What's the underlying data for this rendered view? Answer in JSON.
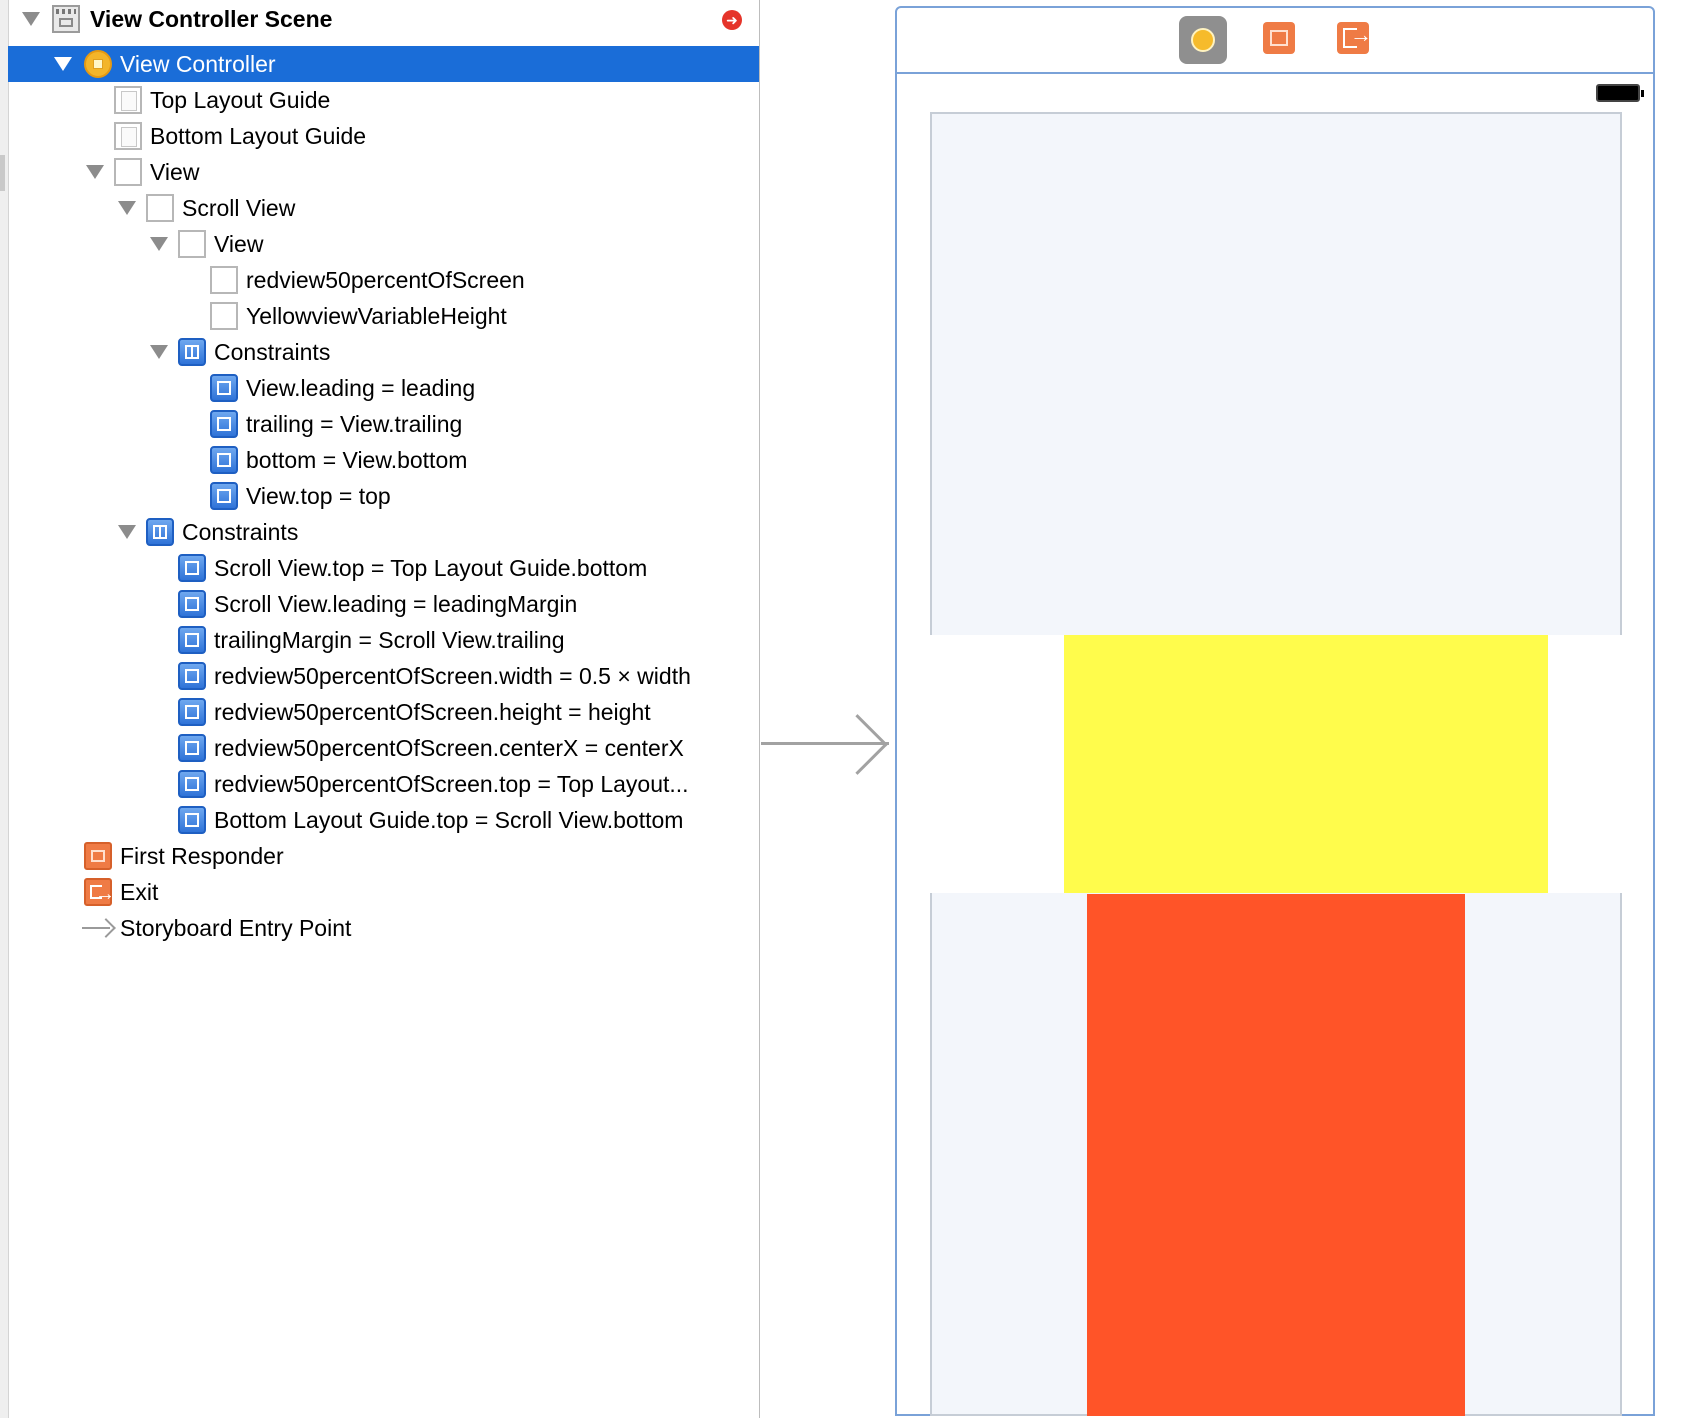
{
  "outline": {
    "scene_title": "View Controller Scene",
    "warning_badge": "➜",
    "rows": [
      {
        "label": "View Controller",
        "icon": "view-controller-icon"
      },
      {
        "label": "Top Layout Guide",
        "icon": "layout-guide-icon"
      },
      {
        "label": "Bottom Layout Guide",
        "icon": "layout-guide-icon"
      },
      {
        "label": "View",
        "icon": "view-icon"
      },
      {
        "label": "Scroll View",
        "icon": "view-icon"
      },
      {
        "label": "View",
        "icon": "view-icon"
      },
      {
        "label": "redview50percentOfScreen",
        "icon": "view-icon"
      },
      {
        "label": "YellowviewVariableHeight",
        "icon": "view-icon"
      },
      {
        "label": "Constraints",
        "icon": "constraints-group-icon"
      },
      {
        "label": "View.leading = leading",
        "icon": "constraint-icon"
      },
      {
        "label": "trailing = View.trailing",
        "icon": "constraint-icon"
      },
      {
        "label": "bottom = View.bottom",
        "icon": "constraint-icon"
      },
      {
        "label": "View.top = top",
        "icon": "constraint-icon"
      },
      {
        "label": "Constraints",
        "icon": "constraints-group-icon"
      },
      {
        "label": "Scroll View.top = Top Layout Guide.bottom",
        "icon": "constraint-icon"
      },
      {
        "label": "Scroll View.leading = leadingMargin",
        "icon": "constraint-icon"
      },
      {
        "label": "trailingMargin = Scroll View.trailing",
        "icon": "constraint-icon"
      },
      {
        "label": "redview50percentOfScreen.width = 0.5 × width",
        "icon": "constraint-icon"
      },
      {
        "label": "redview50percentOfScreen.height = height",
        "icon": "constraint-icon"
      },
      {
        "label": "redview50percentOfScreen.centerX = centerX",
        "icon": "constraint-icon"
      },
      {
        "label": "redview50percentOfScreen.top = Top Layout...",
        "icon": "constraint-icon"
      },
      {
        "label": "Bottom Layout Guide.top = Scroll View.bottom",
        "icon": "constraint-icon"
      },
      {
        "label": "First Responder",
        "icon": "first-responder-icon"
      },
      {
        "label": "Exit",
        "icon": "exit-icon"
      },
      {
        "label": "Storyboard Entry Point",
        "icon": "entry-point-arrow-icon"
      }
    ]
  },
  "canvas": {
    "scene_bar_icons": [
      "view-controller-icon",
      "first-responder-icon",
      "exit-icon"
    ],
    "colors": {
      "selection": "#1a6dd8",
      "yellow_view": "#fffc4c",
      "red_view": "#ff5428",
      "scroll_view_bg": "#f3f6fb",
      "frame_border": "#7aa2d8"
    }
  }
}
